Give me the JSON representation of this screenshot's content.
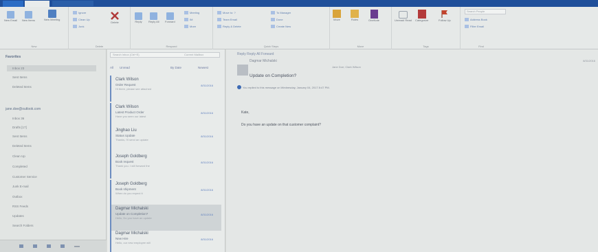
{
  "ribbon": {
    "groups": [
      "New",
      "Delete",
      "Respond",
      "Quick Steps",
      "Move",
      "Tags",
      "Find"
    ],
    "buttons": {
      "new_email": "New Email",
      "new_items": "New Items",
      "new_meeting": "New Meeting",
      "ignore": "Ignore",
      "clean_up": "Clean Up",
      "junk": "Junk",
      "delete": "Delete",
      "reply": "Reply",
      "reply_all": "Reply All",
      "forward": "Forward",
      "meeting": "Meeting",
      "im": "IM",
      "more": "More",
      "move": "Move",
      "rules": "Rules",
      "onenote": "OneNote",
      "unread_read": "Unread/ Read",
      "categorize": "Categorize",
      "follow_up": "Follow Up",
      "address_book": "Address Book",
      "filter_email": "Filter Email",
      "search_people": "Search People"
    },
    "quick_steps": [
      "Move to: ?",
      "Team Email",
      "Reply & Delete",
      "To Manager",
      "Done",
      "Create New"
    ]
  },
  "sidebar": {
    "favorites_header": "Favorites",
    "favorites": [
      "Inbox 23",
      "Sent Items",
      "Deleted Items"
    ],
    "account_header": "jane.doe@outlook.com",
    "folders": [
      "Inbox 36",
      "Drafts [17]",
      "Sent Items",
      "Deleted Items",
      "Clean Up",
      "Completed",
      "Customer Service",
      "Junk E-mail",
      "Outbox",
      "RSS Feeds",
      "Updates",
      "Search Folders"
    ]
  },
  "messagelist": {
    "search_placeholder": "Search Inbox (Ctrl+E)",
    "current_mailbox": "Current Mailbox",
    "filter_all": "All",
    "filter_unread": "Unread",
    "sort_by": "By Date",
    "sort_order": "Newest",
    "messages": [
      {
        "from": "Clark Wilson",
        "subject": "Order Request",
        "preview": "Hi there, please see attached",
        "date": "8/31/2016"
      },
      {
        "from": "Clark Wilson",
        "subject": "Latest Product Order",
        "preview": "Have you seen our latest",
        "date": "8/31/2016"
      },
      {
        "from": "Jinghao Liu",
        "subject": "Status Update",
        "preview": "Thanks, I'll send an update",
        "date": "8/31/2016"
      },
      {
        "from": "Joseph Goldberg",
        "subject": "Book request",
        "preview": "Thank you. I will forward the",
        "date": "8/31/2016"
      },
      {
        "from": "Joseph Goldberg",
        "subject": "Book shipment",
        "preview": "When do you expect it",
        "date": "8/31/2016"
      },
      {
        "from": "Dagmar Michalski",
        "subject": "Update on Completion?",
        "preview": "Hello, Do you have an update",
        "date": "8/31/2016"
      },
      {
        "from": "Dagmar Michalski",
        "subject": "New Hire",
        "preview": "Hello, our new employee will",
        "date": "8/31/2016"
      }
    ]
  },
  "reading": {
    "actions": "Reply  Reply All  Forward",
    "from": "Dagmar Michalski",
    "to": "Jane Doe; Clark Wilson",
    "subject": "Update on Completion?",
    "info": "You replied to this message on Wednesday, January 04, 2017 8:47 PM.",
    "date_right": "8/31/2016",
    "body_greeting": "Kate,",
    "body_text": "Do you have an update on that customer complaint?"
  }
}
